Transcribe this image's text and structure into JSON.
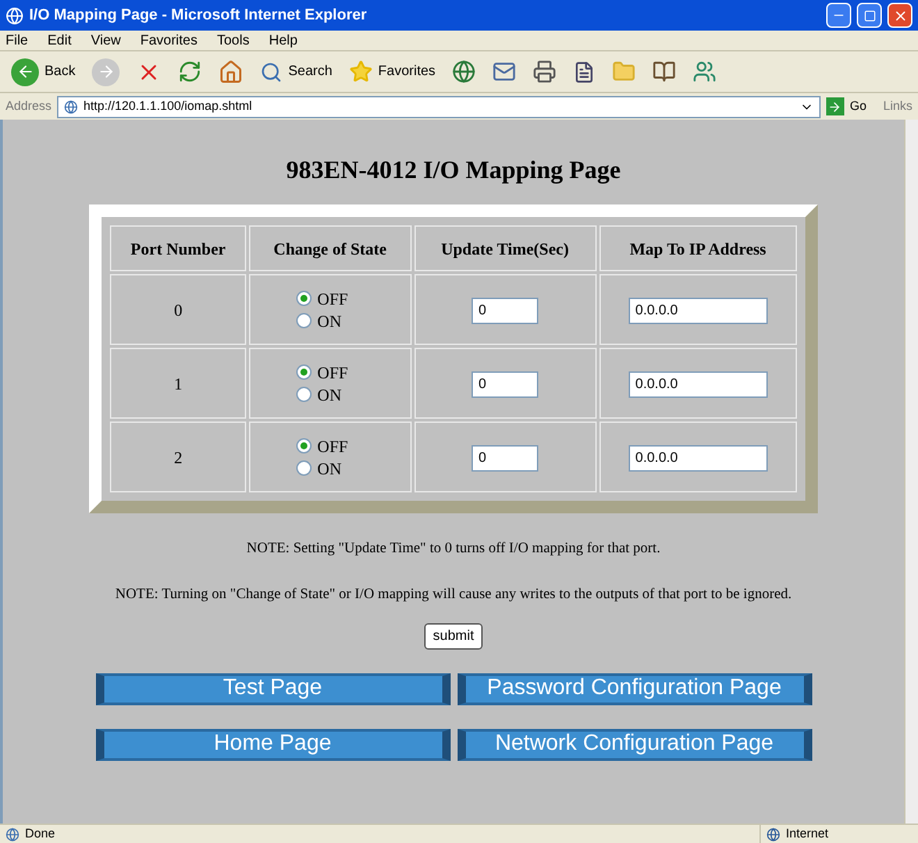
{
  "window": {
    "title": "I/O Mapping Page - Microsoft Internet Explorer"
  },
  "menu": [
    "File",
    "Edit",
    "View",
    "Favorites",
    "Tools",
    "Help"
  ],
  "toolbar": {
    "back": "Back",
    "search": "Search",
    "favorites": "Favorites"
  },
  "address_bar": {
    "label": "Address",
    "url": "http://120.1.1.100/iomap.shtml",
    "go": "Go",
    "links": "Links"
  },
  "page": {
    "heading": "983EN-4012 I/O Mapping Page",
    "table": {
      "columns": [
        "Port Number",
        "Change of State",
        "Update Time(Sec)",
        "Map To IP Address"
      ],
      "rows": [
        {
          "port": "0",
          "options": [
            {
              "label": "OFF",
              "selected": true
            },
            {
              "label": "ON",
              "selected": false
            }
          ],
          "update_time": "0",
          "ip": "0.0.0.0"
        },
        {
          "port": "1",
          "options": [
            {
              "label": "OFF",
              "selected": true
            },
            {
              "label": "ON",
              "selected": false
            }
          ],
          "update_time": "0",
          "ip": "0.0.0.0"
        },
        {
          "port": "2",
          "options": [
            {
              "label": "OFF",
              "selected": true
            },
            {
              "label": "ON",
              "selected": false
            }
          ],
          "update_time": "0",
          "ip": "0.0.0.0"
        }
      ]
    },
    "notes": [
      "NOTE: Setting \"Update Time\" to 0 turns off I/O mapping for that port.",
      "NOTE: Turning on \"Change of State\" or I/O mapping will cause any writes to the outputs of that port to be ignored."
    ],
    "submit": "submit",
    "nav_buttons": [
      "Test Page",
      "Password Configuration Page",
      "Home Page",
      "Network Configuration Page"
    ]
  },
  "status_bar": {
    "text": "Done",
    "zone": "Internet"
  }
}
